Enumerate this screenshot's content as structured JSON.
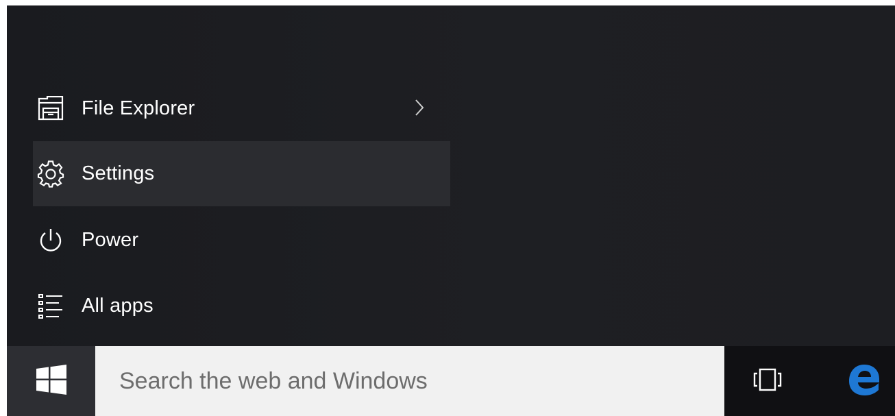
{
  "start_menu": {
    "items": [
      {
        "label": "File Explorer",
        "icon": "file-explorer-icon",
        "has_submenu": true
      },
      {
        "label": "Settings",
        "icon": "gear-icon",
        "highlighted": true
      },
      {
        "label": "Power",
        "icon": "power-icon"
      },
      {
        "label": "All apps",
        "icon": "all-apps-icon"
      }
    ]
  },
  "taskbar": {
    "start_icon": "windows-logo-icon",
    "search": {
      "placeholder": "Search the web and Windows",
      "value": ""
    },
    "task_view_icon": "task-view-icon",
    "edge_icon": "edge-browser-icon"
  },
  "colors": {
    "menu_background": "#1c1d21",
    "highlight": "#2b2c30",
    "taskbar": "#101013",
    "search_box": "#f1f1f1",
    "edge_blue": "#1e78d4"
  }
}
